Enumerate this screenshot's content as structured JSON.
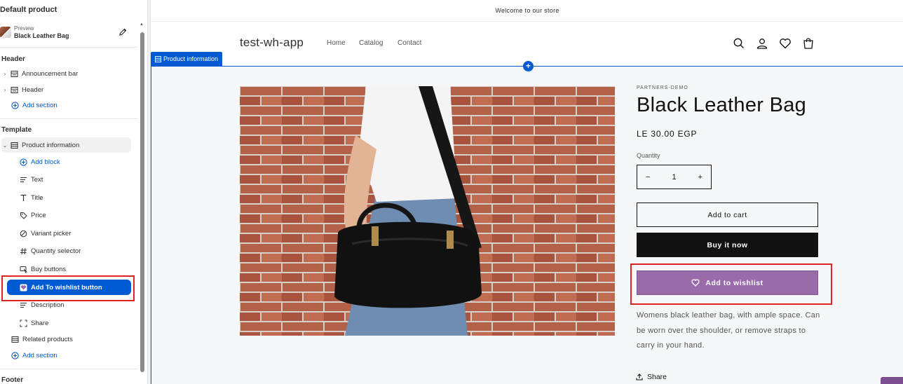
{
  "sidebar": {
    "title": "Default product",
    "preview": {
      "label": "Preview",
      "product": "Black Leather Bag"
    },
    "header_group": "Header",
    "header_items": [
      {
        "label": "Announcement bar",
        "icon": "section-icon"
      },
      {
        "label": "Header",
        "icon": "section-icon"
      }
    ],
    "add_section_label": "Add section",
    "template_group": "Template",
    "product_information": "Product information",
    "add_block_label": "Add block",
    "blocks": [
      {
        "label": "Text",
        "icon": "text-icon"
      },
      {
        "label": "Title",
        "icon": "title-icon"
      },
      {
        "label": "Price",
        "icon": "price-tag-icon"
      },
      {
        "label": "Variant picker",
        "icon": "variant-icon"
      },
      {
        "label": "Quantity selector",
        "icon": "hash-icon"
      },
      {
        "label": "Buy buttons",
        "icon": "cursor-icon"
      },
      {
        "label": "Add To wishlist button",
        "icon": "wishlist-app-icon",
        "selected": true
      },
      {
        "label": "Description",
        "icon": "text-icon"
      },
      {
        "label": "Share",
        "icon": "share-frame-icon"
      }
    ],
    "related_products": "Related products",
    "add_section_label_2": "Add section",
    "footer_group": "Footer"
  },
  "store": {
    "announcement": "Welcome to our store",
    "logo": "test-wh-app",
    "nav": [
      "Home",
      "Catalog",
      "Contact"
    ],
    "section_label": "Product information"
  },
  "product": {
    "vendor": "PARTNERS-DEMO",
    "title": "Black Leather Bag",
    "price": "LE 30.00 EGP",
    "quantity_label": "Quantity",
    "quantity_value": "1",
    "add_to_cart": "Add to cart",
    "buy_now": "Buy it now",
    "add_to_wishlist": "Add to wishlist",
    "description": "Womens black leather bag, with ample space. Can be worn over the shoulder, or remove straps to carry in your hand.",
    "share": "Share"
  },
  "colors": {
    "accent": "#005bd3",
    "wishlist": "#9a6bab",
    "highlight": "#e02424"
  }
}
